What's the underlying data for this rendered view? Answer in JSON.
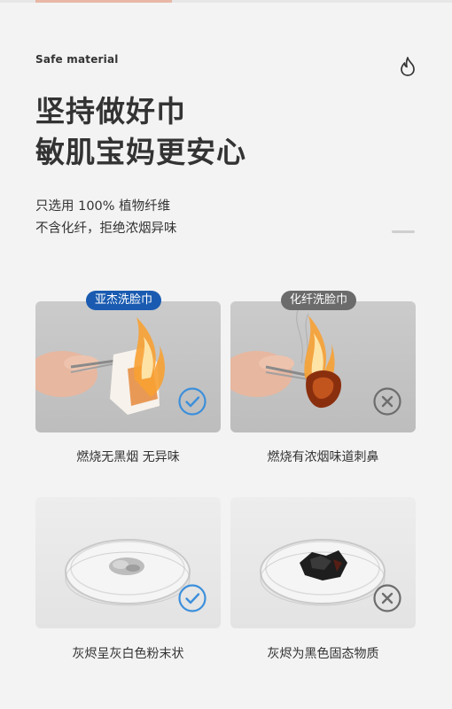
{
  "header": {
    "tag": "Safe material",
    "title_line1": "坚持做好巾",
    "title_line2": "敏肌宝妈更安心",
    "sub_line1": "只选用 100% 植物纤维",
    "sub_line2": "不含化纤，拒绝浓烟异味"
  },
  "compare": {
    "left_label": "亚杰洗脸巾",
    "right_label": "化纤洗脸巾",
    "left_burn_caption": "燃烧无黑烟 无异味",
    "right_burn_caption": "燃烧有浓烟味道刺鼻",
    "left_ash_caption": "灰烬呈灰白色粉末状",
    "right_ash_caption": "灰烬为黑色固态物质"
  },
  "colors": {
    "accent_blue": "#1a5bb1",
    "check_blue": "#3c8fdb",
    "cross_gray": "#6d6d6d"
  },
  "icons": {
    "flame": "flame-icon",
    "check": "check-circle-icon",
    "cross": "cross-circle-icon"
  }
}
